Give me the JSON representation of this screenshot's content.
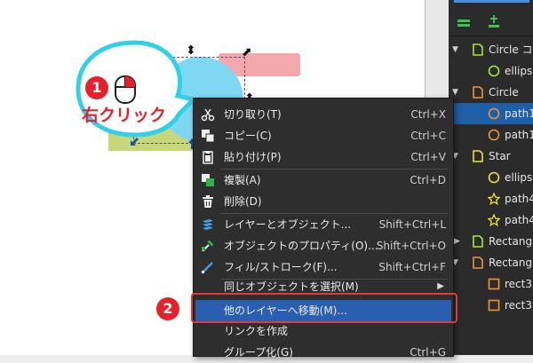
{
  "annotation": {
    "step1_number": "1",
    "step1_label": "右クリック",
    "step2_number": "2"
  },
  "layers_panel": {
    "rows": [
      {
        "label": "Circle コピ",
        "type": "group"
      },
      {
        "label": "ellipse",
        "type": "ellipse"
      },
      {
        "label": "Circle",
        "type": "group"
      },
      {
        "label": "path1",
        "type": "ellipse"
      },
      {
        "label": "path1",
        "type": "ellipse"
      },
      {
        "label": "Star",
        "type": "group"
      },
      {
        "label": "ellipse",
        "type": "ellipse"
      },
      {
        "label": "path4",
        "type": "star"
      },
      {
        "label": "path4",
        "type": "star"
      },
      {
        "label": "Rectangl",
        "type": "group"
      },
      {
        "label": "Rectangl",
        "type": "group"
      },
      {
        "label": "rect3",
        "type": "rect"
      },
      {
        "label": "rect3",
        "type": "rect"
      }
    ]
  },
  "context_menu": {
    "items": [
      {
        "label": "切り取り(T)",
        "shortcut": "Ctrl+X",
        "icon": "scissors-icon"
      },
      {
        "label": "コピー(C)",
        "shortcut": "Ctrl+C",
        "icon": "copy-icon"
      },
      {
        "label": "貼り付け(P)",
        "shortcut": "Ctrl+V",
        "icon": "paste-icon"
      },
      {
        "label": "複製(A)",
        "shortcut": "Ctrl+D",
        "icon": "duplicate-icon"
      },
      {
        "label": "削除(D)",
        "shortcut": "",
        "icon": "trash-icon"
      },
      {
        "label": "レイヤーとオブジェクト...",
        "shortcut": "Shift+Ctrl+L",
        "icon": "layers-icon"
      },
      {
        "label": "オブジェクトのプロパティ(O)...",
        "shortcut": "Shift+Ctrl+O",
        "icon": "properties-icon"
      },
      {
        "label": "フィル/ストローク(F)...",
        "shortcut": "Shift+Ctrl+F",
        "icon": "fill-stroke-icon"
      },
      {
        "label": "同じオブジェクトを選択(M)",
        "shortcut": "",
        "icon": "",
        "submenu": true
      },
      {
        "label": "他のレイヤーへ移動(M)...",
        "shortcut": "",
        "icon": ""
      },
      {
        "label": "リンクを作成",
        "shortcut": "",
        "icon": ""
      },
      {
        "label": "グループ化(G)",
        "shortcut": "Ctrl+G",
        "icon": ""
      }
    ]
  },
  "colors": {
    "accent_blue": "#2a5fb0",
    "annotation_red": "#e8202c",
    "circle_fill": "#7fd8f2",
    "rect_pink": "#f4a7ad",
    "rect_green": "#c7d77a",
    "group_green": "#a9e23a",
    "group_orange": "#f0913a",
    "star_yellow": "#e8e23a"
  }
}
